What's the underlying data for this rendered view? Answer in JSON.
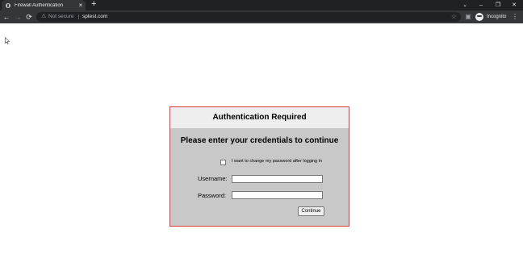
{
  "browser": {
    "tab_title": "Firewall Authentication",
    "tab_close": "×",
    "new_tab": "+",
    "window_controls": {
      "minimize": "–",
      "restore": "❐",
      "close": "✕",
      "dropdown": "⌄"
    },
    "nav": {
      "back": "←",
      "forward": "→",
      "reload": "⟳"
    },
    "address": {
      "security_label": "Not secure",
      "url": "sptest.com",
      "warning_icon": "⚠"
    },
    "incognito_label": "Incognito"
  },
  "auth": {
    "header": "Authentication Required",
    "subtitle": "Please enter your credentials to continue",
    "checkbox_label": "I want to change my password after logging in",
    "checkbox_checked": false,
    "username_label": "Username:",
    "username_value": "",
    "password_label": "Password:",
    "password_value": "",
    "continue_label": "Continue"
  },
  "colors": {
    "border_accent": "#e03a3a",
    "panel_bg": "#c8c8c8",
    "header_bg": "#eeeeee"
  }
}
